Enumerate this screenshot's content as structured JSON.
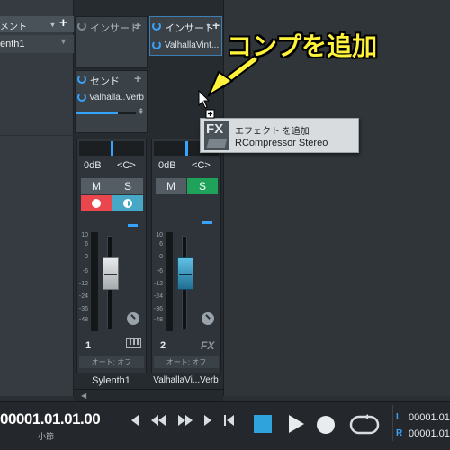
{
  "left_panel": {
    "header_label": "メント",
    "row_label": "enth1"
  },
  "channel1": {
    "insert_header": "インサート",
    "send_header": "センド",
    "send_plugin": "Valhalla..Verb",
    "volume": "0dB",
    "pan": "<C>",
    "mute_label": "M",
    "solo_label": "S",
    "number": "1",
    "automation": "オート: オフ",
    "name": "Sylenth1",
    "scale": [
      "10",
      "6",
      "0",
      "-6",
      "-12",
      "-24",
      "-36",
      "-48"
    ],
    "fader_level": 0.62
  },
  "channel2": {
    "insert_header": "インサート",
    "insert_plugin": "ValhallaVint...",
    "volume": "0dB",
    "pan": "<C>",
    "mute_label": "M",
    "solo_label": "S",
    "solo_active": true,
    "number": "2",
    "fx_label": "FX",
    "automation": "オート: オフ",
    "name": "ValhallaVi...Verb",
    "scale": [
      "10",
      "6",
      "0",
      "-6",
      "-12",
      "-24",
      "-36",
      "-48"
    ],
    "fader_level": 0.62
  },
  "tooltip": {
    "fx_badge": "FX",
    "title": "エフェクト を追加",
    "plugin": "RCompressor Stereo"
  },
  "annotation": {
    "text": "コンプを追加",
    "color": "#fff23a"
  },
  "transport": {
    "position": "00001.01.01.00",
    "position_unit": "小節",
    "loop_left_label": "L",
    "loop_left_value": "00001.01",
    "loop_right_label": "R",
    "loop_right_value": "00001.01"
  },
  "colors": {
    "accent_blue": "#36a4ff",
    "solo_green": "#1fa35b",
    "record_red": "#e9474d",
    "monitor_teal": "#46a7c6",
    "stop_blue": "#2ea3dc"
  }
}
